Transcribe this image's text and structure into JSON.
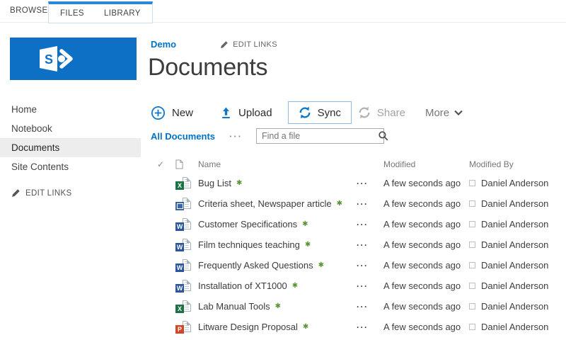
{
  "ribbon": {
    "browse_tab": "BROWSE",
    "files_tab": "FILES",
    "library_tab": "LIBRARY"
  },
  "sidebar": {
    "items": [
      {
        "label": "Home",
        "selected": false
      },
      {
        "label": "Notebook",
        "selected": false
      },
      {
        "label": "Documents",
        "selected": true
      },
      {
        "label": "Site Contents",
        "selected": false
      }
    ],
    "edit_links_label": "EDIT LINKS"
  },
  "header": {
    "site_link": "Demo",
    "edit_links_label": "EDIT LINKS",
    "page_title": "Documents"
  },
  "toolbar": {
    "new_label": "New",
    "upload_label": "Upload",
    "sync_label": "Sync",
    "share_label": "Share",
    "more_label": "More"
  },
  "viewbar": {
    "current_view": "All Documents",
    "menu_ellipsis": "···",
    "search_placeholder": "Find a file"
  },
  "table": {
    "headers": {
      "select_all": "✓",
      "name": "Name",
      "modified": "Modified",
      "modified_by": "Modified By"
    },
    "new_badge_glyph": "✱",
    "row_menu_glyph": "···",
    "rows": [
      {
        "name": "Bug List",
        "type": "excel",
        "letter": "X",
        "is_new": true,
        "modified": "A few seconds ago",
        "modified_by": "Daniel Anderson"
      },
      {
        "name": "Criteria sheet, Newspaper article",
        "type": "wordimg",
        "letter": "",
        "is_new": true,
        "modified": "A few seconds ago",
        "modified_by": "Daniel Anderson"
      },
      {
        "name": "Customer Specifications",
        "type": "word",
        "letter": "W",
        "is_new": true,
        "modified": "A few seconds ago",
        "modified_by": "Daniel Anderson"
      },
      {
        "name": "Film techniques teaching",
        "type": "word",
        "letter": "W",
        "is_new": true,
        "modified": "A few seconds ago",
        "modified_by": "Daniel Anderson"
      },
      {
        "name": "Frequently Asked Questions",
        "type": "word",
        "letter": "W",
        "is_new": true,
        "modified": "A few seconds ago",
        "modified_by": "Daniel Anderson"
      },
      {
        "name": "Installation of XT1000",
        "type": "word",
        "letter": "W",
        "is_new": true,
        "modified": "A few seconds ago",
        "modified_by": "Daniel Anderson"
      },
      {
        "name": "Lab Manual Tools",
        "type": "excel",
        "letter": "X",
        "is_new": true,
        "modified": "A few seconds ago",
        "modified_by": "Daniel Anderson"
      },
      {
        "name": "Litware Design Proposal",
        "type": "ppt",
        "letter": "P",
        "is_new": true,
        "modified": "A few seconds ago",
        "modified_by": "Daniel Anderson"
      }
    ]
  },
  "icons": {
    "logo-icon": "sharepoint-s-glyph",
    "new-icon": "circle-plus",
    "upload-icon": "up-arrow-with-baseline",
    "sync-icon": "two-circular-arrows",
    "share-icon": "circular-arrows-gray",
    "more-chevron-icon": "chevron-down",
    "search-icon": "magnifier",
    "edit-pencil-icon": "pencil",
    "select-all-icon": "checkmark",
    "file-column-icon": "page-outline",
    "presence-icon": "status-square",
    "new-item-badge": "green-starburst"
  },
  "colors": {
    "accent_blue": "#0072c6",
    "logo_blue": "#0e70c4",
    "tab_highlight_blue": "#2b87d8",
    "sync_border_blue": "#8db9e3",
    "new_badge_green": "#5b9432",
    "excel_green": "#1e7145",
    "word_blue": "#2b579a",
    "powerpoint_orange": "#d04727",
    "selected_nav_bg": "#ededed"
  }
}
